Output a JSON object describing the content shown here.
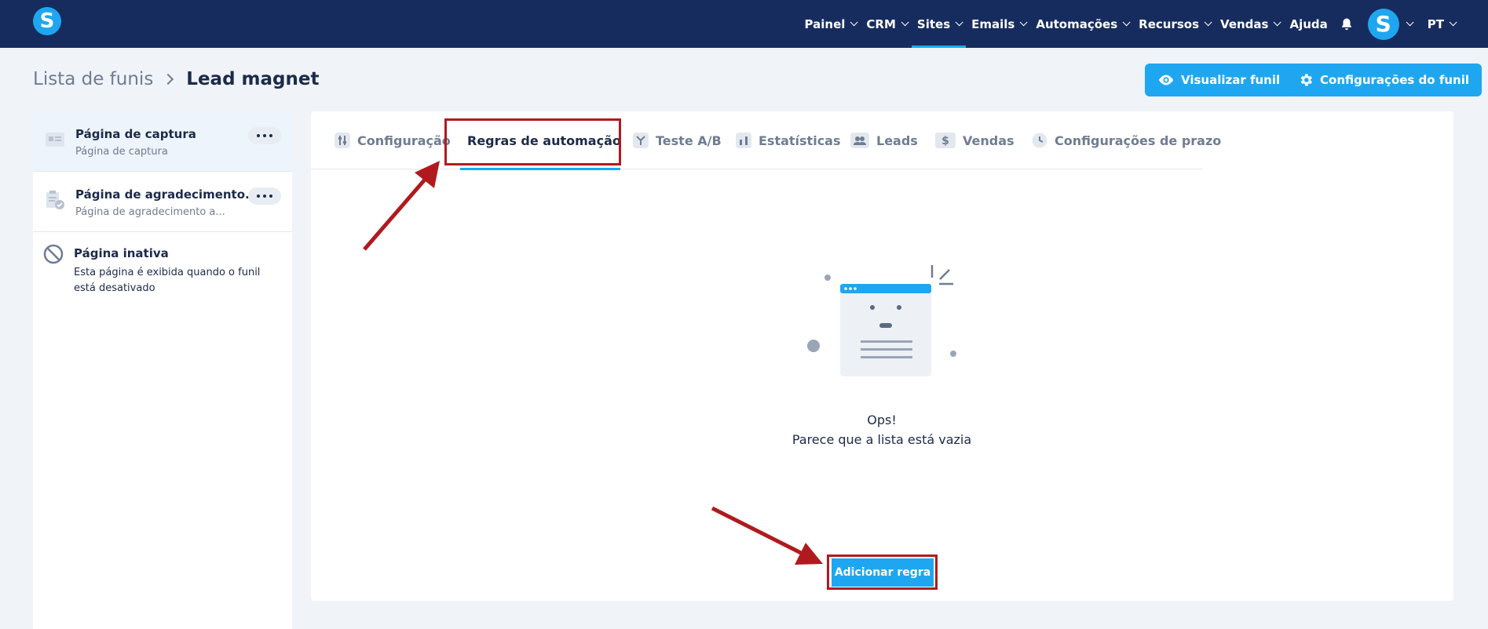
{
  "topbar": {
    "logo_letter": "S",
    "nav": [
      {
        "label": "Painel",
        "has_menu": true
      },
      {
        "label": "CRM",
        "has_menu": true
      },
      {
        "label": "Sites",
        "has_menu": true,
        "active": true
      },
      {
        "label": "Emails",
        "has_menu": true
      },
      {
        "label": "Automações",
        "has_menu": true
      },
      {
        "label": "Recursos",
        "has_menu": true
      },
      {
        "label": "Vendas",
        "has_menu": true
      },
      {
        "label": "Ajuda",
        "has_menu": false
      }
    ],
    "avatar_letter": "S",
    "language": "PT"
  },
  "header": {
    "breadcrumb_root": "Lista de funis",
    "breadcrumb_current": "Lead magnet",
    "preview_button": "Visualizar funil",
    "settings_button": "Configurações do funil"
  },
  "sidebar": {
    "pages": [
      {
        "title": "Página de captura",
        "subtitle": "Página de captura",
        "selected": true
      },
      {
        "title": "Página de agradecimento...",
        "subtitle": "Página de agradecimento a..."
      }
    ],
    "inactive": {
      "title": "Página inativa",
      "description": "Esta página é exibida quando o funil está desativado"
    }
  },
  "tabs": [
    {
      "label": "Configuração",
      "icon": "sliders-icon"
    },
    {
      "label": "Regras de automação",
      "icon": "bolt-icon",
      "active": true
    },
    {
      "label": "Teste A/B",
      "icon": "split-icon"
    },
    {
      "label": "Estatísticas",
      "icon": "bar-chart-icon"
    },
    {
      "label": "Leads",
      "icon": "users-icon"
    },
    {
      "label": "Vendas",
      "icon": "dollar-icon"
    },
    {
      "label": "Configurações de prazo",
      "icon": "clock-icon"
    }
  ],
  "empty_state": {
    "title": "Ops!",
    "subtitle": "Parece que a lista está vazia"
  },
  "add_rule_button": "Adicionar regra",
  "colors": {
    "navbar": "#172c5e",
    "accent": "#1ea7f0",
    "annotation_red": "#b01a1e"
  }
}
